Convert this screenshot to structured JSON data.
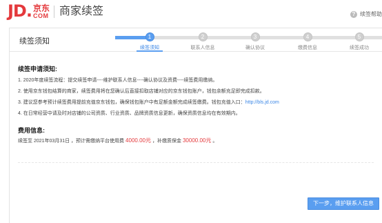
{
  "header": {
    "logo_jd": "JD.",
    "logo_zh": "京东",
    "logo_com": "COM",
    "title": "商家续签",
    "help": {
      "icon": "question-icon",
      "label": "续签帮助"
    }
  },
  "panel": {
    "title": "续签须知"
  },
  "steps": [
    {
      "num": "1",
      "label": "续签须知",
      "active": true
    },
    {
      "num": "2",
      "label": "联系人信息",
      "active": false
    },
    {
      "num": "3",
      "label": "确认协议",
      "active": false
    },
    {
      "num": "4",
      "label": "缴费信息",
      "active": false
    },
    {
      "num": "5",
      "label": "续签成功",
      "active": false
    }
  ],
  "notice": {
    "title": "续签申请须知:",
    "items": [
      "1. 2020年度续签流程：提交续签申请----维护联系人信息----确认协议及资费----续签费用缴纳。",
      "2. 使用京东钱包结算的商家，续签费用将在您确认后直接扣取店铺对应的京东钱包账户，钱包余额充足即完成扣款。",
      "3. 建议您参考预计续签费用提前充值京东钱包，确保钱包账户中有足额金额完成续签缴费。钱包充值入口：",
      "4. 在日常经营中请及时对店铺的公司资质、行业资质、品牌资质信息更新，确保资质信息均在有效期内。"
    ],
    "recharge_url": "http://bls.jd.com"
  },
  "fee": {
    "title": "费用信息:",
    "prefix": "续签至 2021年03月31日 ，预计需缴纳平台使用费",
    "platform_fee": "4000.00元",
    "middle": "，补缴质保金",
    "deposit": "30000.00元",
    "suffix": "。"
  },
  "actions": {
    "next_label": "下一步，维护联系人信息"
  },
  "colors": {
    "brand": "#e4393c",
    "accent": "#5a9ef0"
  }
}
